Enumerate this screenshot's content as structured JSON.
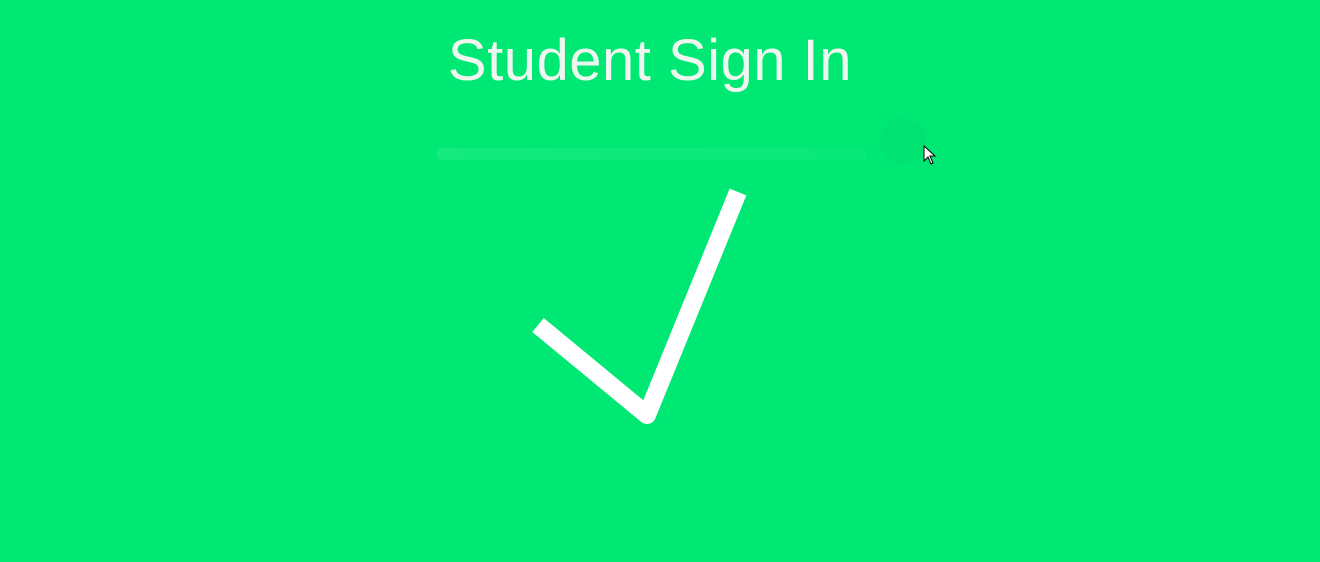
{
  "header": {
    "title": "Student Sign In"
  },
  "status": {
    "icon": "checkmark-icon",
    "state": "success"
  },
  "cursor": {
    "icon": "mouse-pointer-icon"
  },
  "colors": {
    "background": "#00e874",
    "checkmark": "#ffffff",
    "title": "#eef7ef"
  }
}
